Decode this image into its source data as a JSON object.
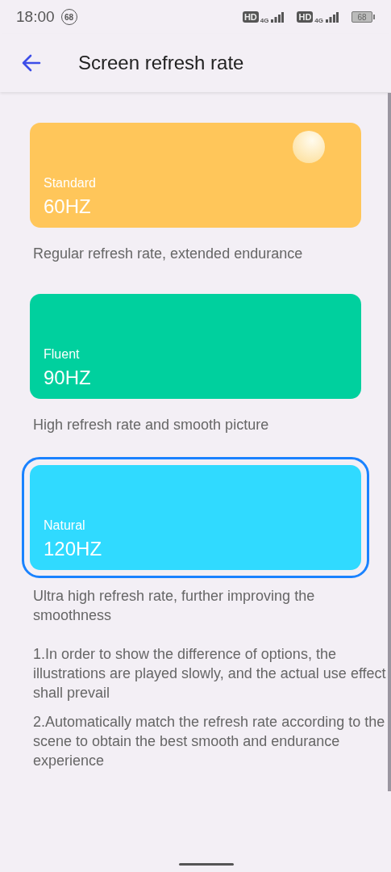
{
  "status_bar": {
    "time": "18:00",
    "notification_badge": "68",
    "sim_1": {
      "hd": "HD",
      "network": "4G"
    },
    "sim_2": {
      "hd": "HD",
      "network": "4G"
    },
    "battery": "68"
  },
  "header": {
    "title": "Screen refresh rate"
  },
  "options": [
    {
      "label": "Standard",
      "rate": "60HZ",
      "color": "#ffc65a",
      "description": "Regular refresh rate, extended endurance",
      "selected": false,
      "bubble": true
    },
    {
      "label": "Fluent",
      "rate": "90HZ",
      "color": "#00d09e",
      "description": "High refresh rate and smooth picture",
      "selected": false
    },
    {
      "label": "Natural",
      "rate": "120HZ",
      "color": "#30daff",
      "description": "Ultra high refresh rate, further improving the smoothness",
      "selected": true
    }
  ],
  "notes": [
    "1.In order to show the difference of options, the illustrations are played slowly, and the actual use effect shall prevail",
    "2.Automatically match the refresh rate according to the scene to obtain the best smooth and endurance experience"
  ]
}
